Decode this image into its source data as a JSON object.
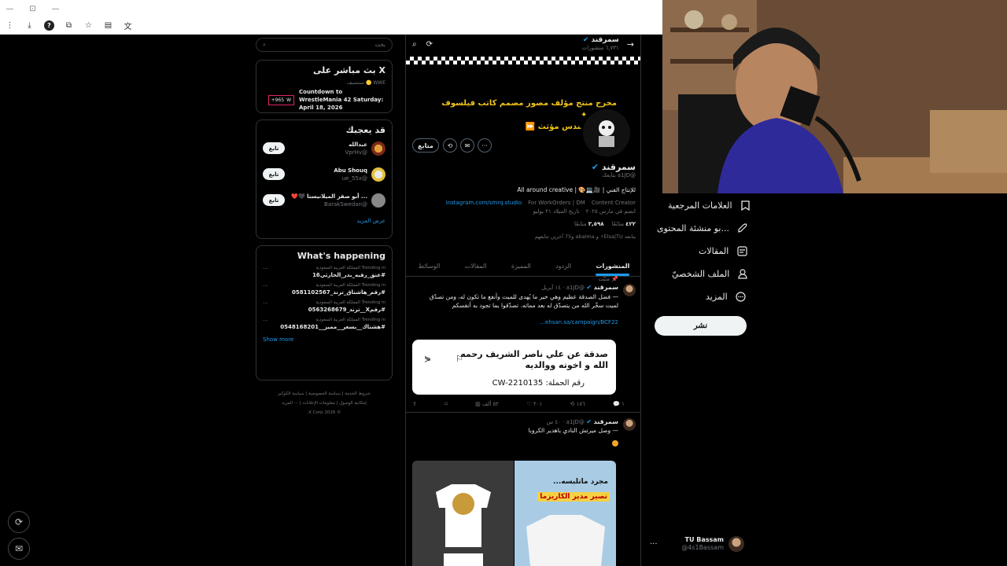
{
  "browser": {
    "window_controls": [
      "—",
      "⊡",
      "—"
    ]
  },
  "nav": {
    "items": [
      {
        "label": "العلامات المرجعية",
        "icon": "bookmark-icon"
      },
      {
        "label": "...بو منشئة المحتوى",
        "icon": "rocket-icon"
      },
      {
        "label": "المقالات",
        "icon": "article-icon"
      },
      {
        "label": "الملف الشخصيّ",
        "icon": "profile-icon"
      },
      {
        "label": "المزيد",
        "icon": "more-icon"
      }
    ],
    "post_label": "نشر",
    "account_name": "TU Bassam",
    "account_handle": "@4s1Bassam"
  },
  "profile": {
    "header_name": "سمرقند",
    "header_count": "٦,٧٣١ منشورات",
    "banner_line1": "مخرج منتج مؤلف مصور مصمم كاتب فيلسوف إعلامي ✦",
    "banner_line2": "كوتش مهندس مؤثث ⏩",
    "follow_label": "متابع",
    "name": "سمرقند",
    "handle": "@a1JD يتابعك",
    "bio": "للإنتاج الفني | 🎥💻🎨 | All around creative",
    "category": "Content Creator",
    "location": "For WorkOrders | DM",
    "link": "instagram.com/smrq.studio",
    "joined": "انضم في مارس ٢٠٢٥",
    "birthday": "تاريخ الميلاد ٢١ يوليو",
    "following_count": "٤٢٢",
    "following_label": "متابَعًا",
    "followers_count": "٣,٥٩٨",
    "followers_label": "متابعًا",
    "followed_by": "يتابعه Elsa|TU⚡ و abalma و75 آخرين تتابعهم"
  },
  "tabs": [
    {
      "label": "المنشورات",
      "active": true
    },
    {
      "label": "الردود",
      "active": false
    },
    {
      "label": "المميزة",
      "active": false
    },
    {
      "label": "المقالات",
      "active": false
    },
    {
      "label": "الوسائط",
      "active": false
    }
  ],
  "tweet1": {
    "pinned_label": "مثبَّت",
    "name": "سمرقند",
    "meta": "@a1JD · ١٤ أبريل",
    "text": "— فضل الصدقة عظيم وهي خير ما يُهدى للميت وأنفع ما تكون له، ومن تصدّق لميت سخّر الله من يتصدّق له بعد مماته. تصدّقوا بما تجود به أنفسكم",
    "link": "ehsan.sa/campaign/BCF22...",
    "card_title": "صدقة عن علي ناصر الشريف رحمه الله و اخوته ووالديه",
    "card_sub": "رقم الحملة: CW-2210135",
    "replies": "١",
    "retweets": "١٨٦",
    "likes": "٢٠١",
    "views": "٥٢ ألف"
  },
  "tweet2": {
    "name": "سمرقند",
    "meta": "@a1JD · ٤٠ س",
    "text": "— وصل ميرتش النادي باهدير الكروبا",
    "image2_text1": "مجرد ماتلبسه...",
    "image2_text2": "تصير مدير الكاريزما"
  },
  "right": {
    "search_placeholder": "بحث",
    "live_title": "X بث مباشر على",
    "live_host": "WWE 🟡 تستضيف",
    "live_event": "Countdown to WrestleMania 42 Saturday: April 18, 2026",
    "live_badge": "965+",
    "who_title": "قد يعجبك",
    "who": [
      {
        "name": "عبدالله",
        "handle": "@VprHv"
      },
      {
        "name": "Abu Shouq",
        "handle": "@ue_55x"
      },
      {
        "name": "... أبو صقر الميلانيستا 🖤❤️",
        "handle": "@BarakSwedan"
      }
    ],
    "follow_label": "تابع",
    "show_more_who": "عرض المزيد",
    "happening_title": "What's happening",
    "trends": [
      {
        "context": "Trending in المملكة العربية السعودية",
        "name": "#عنق_رقبه_بدر_الحارثي16"
      },
      {
        "context": "Trending in المملكة العربية السعودية",
        "name": "#رقم_هاشتاق_ترند_0581102567"
      },
      {
        "context": "Trending in المملكة العربية السعودية",
        "name": "#رقمX__ترند_0563268679"
      },
      {
        "context": "Trending in المملكة العربية السعودية",
        "name": "#هشتاك__بسعر__مميز__0548168201"
      }
    ],
    "show_more": "Show more",
    "footer1": "شروط الخدمة | سياسة الخصوصية | سياسة الكوكيز",
    "footer2": "إمكانية الوصول | معلومات الإعلانات | ··· المزيد",
    "footer3": "© 2026 X Corp."
  },
  "colors": {
    "accent": "#1d9bf0",
    "background": "#000000",
    "banner_text": "#f0c419"
  }
}
